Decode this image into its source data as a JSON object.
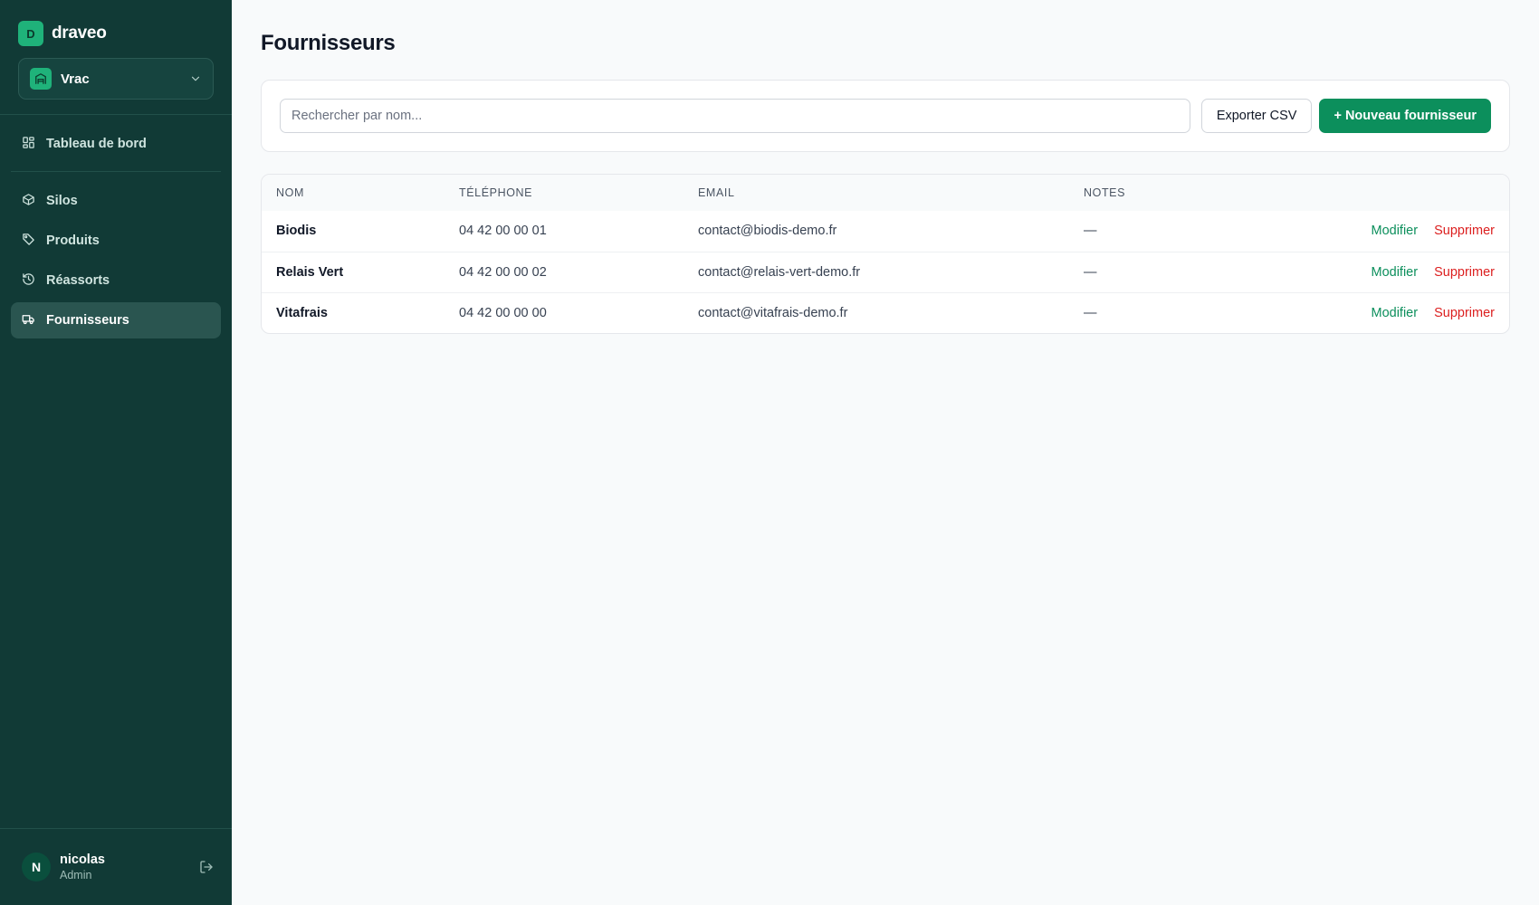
{
  "brand": {
    "logo_letter": "D",
    "name": "draveo"
  },
  "workspace": {
    "name": "Vrac"
  },
  "nav": {
    "items": [
      {
        "label": "Tableau de bord",
        "icon": "dashboard-icon"
      },
      {
        "label": "Silos",
        "icon": "box-icon"
      },
      {
        "label": "Produits",
        "icon": "tag-icon"
      },
      {
        "label": "Réassorts",
        "icon": "history-icon"
      },
      {
        "label": "Fournisseurs",
        "icon": "truck-icon",
        "active": true
      }
    ]
  },
  "user": {
    "initial": "N",
    "name": "nicolas",
    "role": "Admin"
  },
  "page": {
    "title": "Fournisseurs"
  },
  "toolbar": {
    "search_placeholder": "Rechercher par nom...",
    "search_value": "",
    "export_label": "Exporter CSV",
    "new_label": "+ Nouveau fournisseur"
  },
  "table": {
    "columns": [
      "NOM",
      "TÉLÉPHONE",
      "EMAIL",
      "NOTES"
    ],
    "rows": [
      {
        "nom": "Biodis",
        "telephone": "04 42 00 00 01",
        "email": "contact@biodis-demo.fr",
        "notes": "—"
      },
      {
        "nom": "Relais Vert",
        "telephone": "04 42 00 00 02",
        "email": "contact@relais-vert-demo.fr",
        "notes": "—"
      },
      {
        "nom": "Vitafrais",
        "telephone": "04 42 00 00 00",
        "email": "contact@vitafrais-demo.fr",
        "notes": "—"
      }
    ],
    "edit_label": "Modifier",
    "delete_label": "Supprimer"
  },
  "colors": {
    "sidebar_bg": "#113a36",
    "accent": "#0c8f5c",
    "danger": "#dc1f1f"
  }
}
